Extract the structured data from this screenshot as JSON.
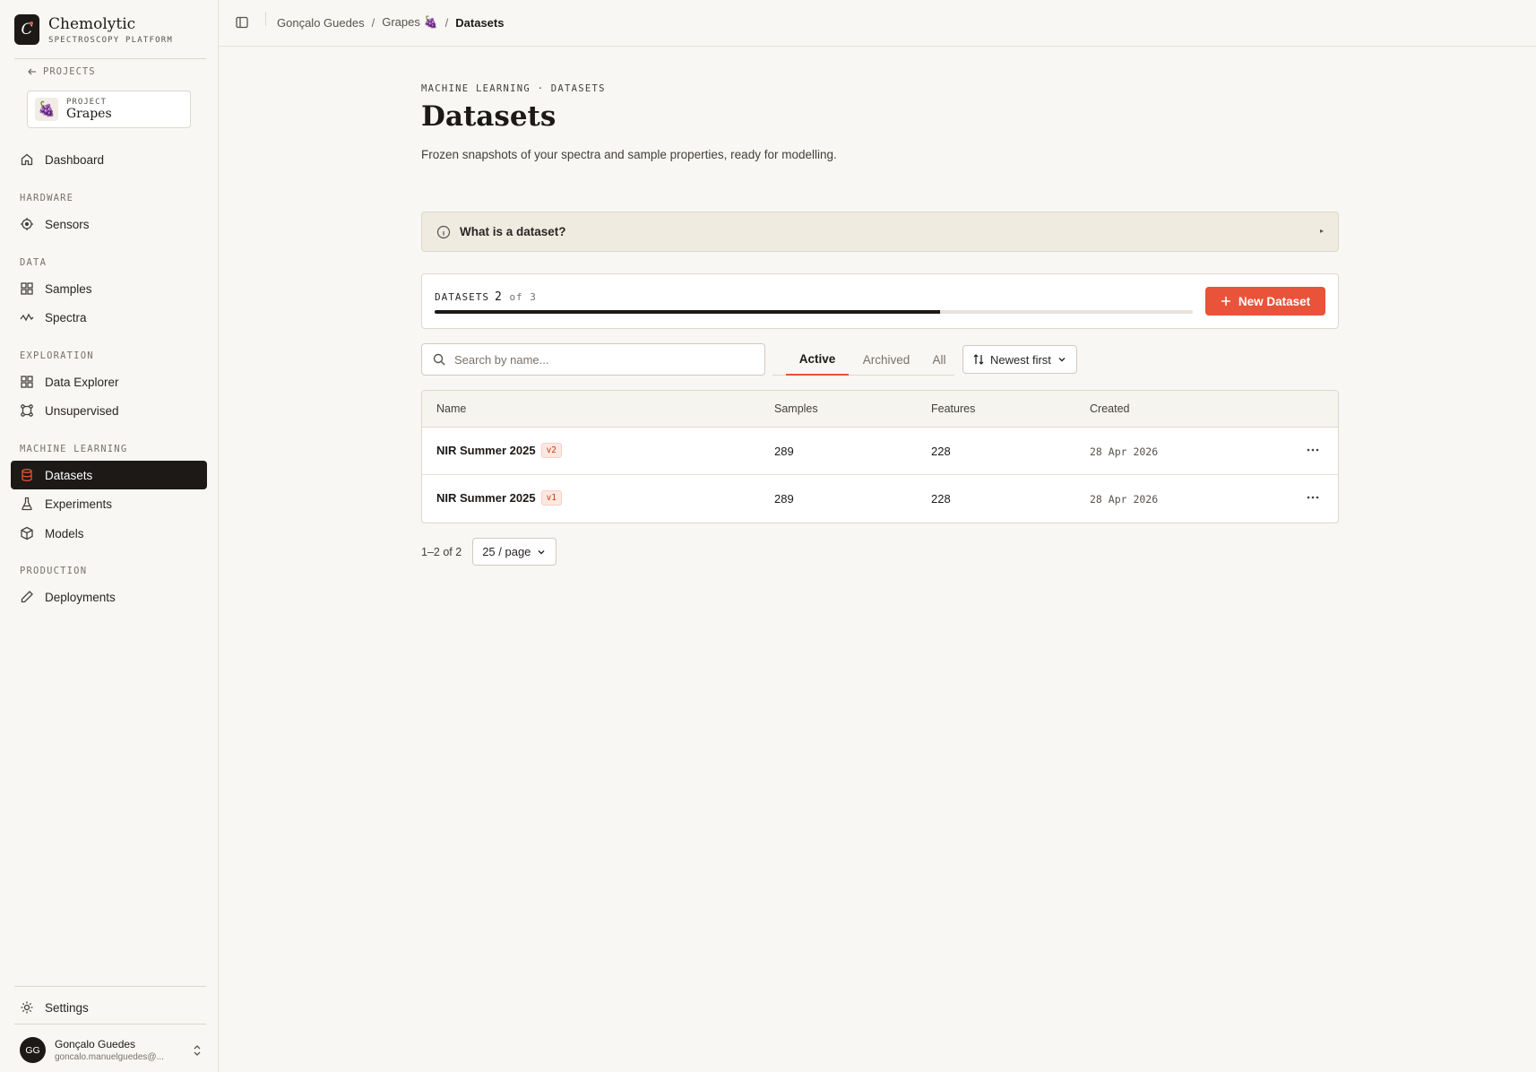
{
  "brand": {
    "name": "Chemolytic",
    "subtitle": "SPECTROSCOPY PLATFORM",
    "logo_letter": "C"
  },
  "project": {
    "back_label": "PROJECTS",
    "eyebrow": "PROJECT",
    "name": "Grapes",
    "emoji": "🍇"
  },
  "nav": {
    "dashboard": "Dashboard",
    "sections": {
      "hardware": "HARDWARE",
      "data": "DATA",
      "exploration": "EXPLORATION",
      "machine_learning": "MACHINE LEARNING",
      "production": "PRODUCTION"
    },
    "items": {
      "sensors": "Sensors",
      "samples": "Samples",
      "spectra": "Spectra",
      "data_explorer": "Data Explorer",
      "unsupervised": "Unsupervised",
      "datasets": "Datasets",
      "experiments": "Experiments",
      "models": "Models",
      "deployments": "Deployments"
    },
    "active": "datasets",
    "settings": "Settings"
  },
  "user": {
    "initials": "GG",
    "name": "Gonçalo Guedes",
    "email": "goncalo.manuelguedes@..."
  },
  "breadcrumb": {
    "items": [
      "Gonçalo Guedes",
      "Grapes 🍇",
      "Datasets"
    ]
  },
  "page": {
    "eyebrow": "MACHINE LEARNING · DATASETS",
    "title": "Datasets",
    "description": "Frozen snapshots of your spectra and sample properties, ready for modelling."
  },
  "info": {
    "label": "What is a dataset?",
    "caret": "▸"
  },
  "quota": {
    "label": "DATASETS",
    "used": "2",
    "of_text": "of 3",
    "fraction": 0.667
  },
  "new_button": {
    "label": "New Dataset"
  },
  "search": {
    "placeholder": "Search by name...",
    "value": ""
  },
  "tabs": [
    "Active",
    "Archived",
    "All"
  ],
  "active_tab": "Active",
  "sort": {
    "label": "Newest first"
  },
  "table": {
    "columns": [
      "Name",
      "Samples",
      "Features",
      "Created"
    ],
    "rows": [
      {
        "name": "NIR Summer 2025",
        "version": "v2",
        "samples": "289",
        "features": "228",
        "created": "28 Apr 2026"
      },
      {
        "name": "NIR Summer 2025",
        "version": "v1",
        "samples": "289",
        "features": "228",
        "created": "28 Apr 2026"
      }
    ]
  },
  "pagination": {
    "range": "1–2 of 2",
    "per_page": "25 / page"
  },
  "colors": {
    "accent": "#e8533a",
    "dark": "#1c1917",
    "background": "#f8f7f3"
  }
}
